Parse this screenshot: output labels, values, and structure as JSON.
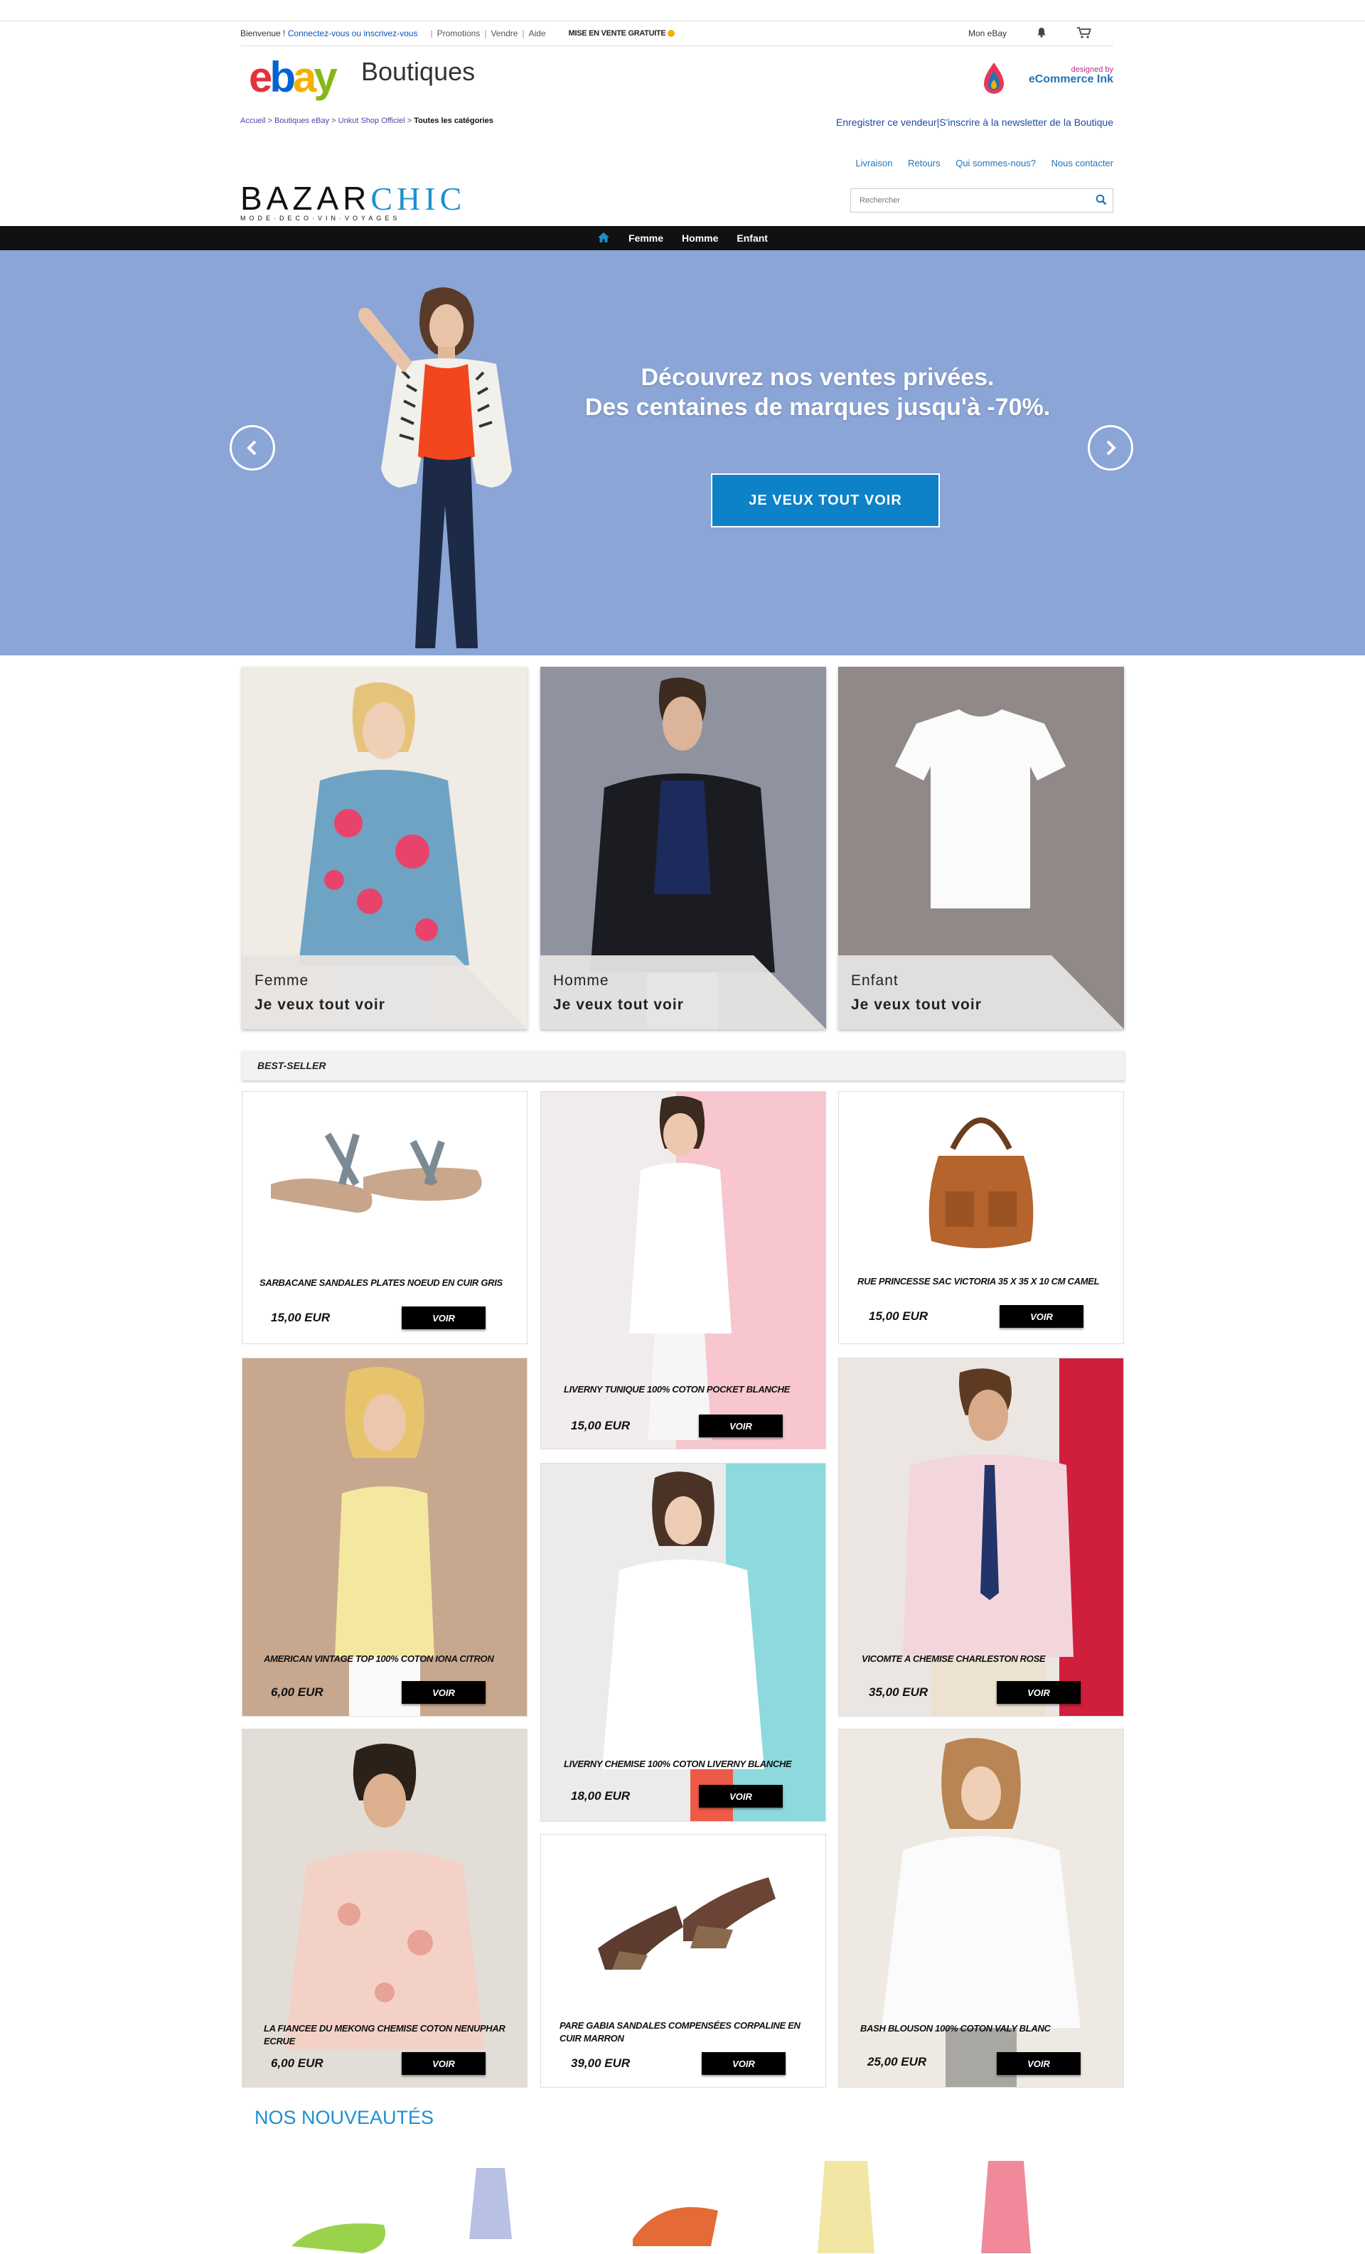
{
  "topbar": {
    "welcome": "Bienvenue !",
    "login": "Connectez-vous ou inscrivez-vous",
    "links": [
      "Promotions",
      "Vendre",
      "Aide"
    ],
    "free_listing": "MISE EN VENTE GRATUITE",
    "my_ebay": "Mon eBay"
  },
  "header": {
    "logo": {
      "e": "e",
      "b": "b",
      "a": "a",
      "y": "y"
    },
    "section": "Boutiques",
    "designed_by": "designed by",
    "designer": "eCommerce Ink"
  },
  "breadcrumb": {
    "items": [
      "Accueil",
      "Boutiques eBay",
      "Unkut Shop Officiel"
    ],
    "current": "Toutes les catégories",
    "sep": ">",
    "register": "Enregistrer ce vendeur",
    "newsletter": "S'inscrire à la newsletter de la Boutique"
  },
  "store": {
    "nav": [
      "Livraison",
      "Retours",
      "Qui sommes-nous?",
      "Nous contacter"
    ],
    "brand_a": "BAZAR",
    "brand_b": "CHIC",
    "tagline": "MODE·DECO·VIN·VOYAGES",
    "search_placeholder": "Rechercher"
  },
  "menu": {
    "items": [
      "Femme",
      "Homme",
      "Enfant"
    ]
  },
  "hero": {
    "line1": "Découvrez nos ventes privées.",
    "line2": "Des centaines de marques jusqu'à -70%.",
    "cta": "JE VEUX TOUT VOIR",
    "bg": "#8aa5d6"
  },
  "categories": [
    {
      "name": "Femme",
      "cta": "Je veux tout voir"
    },
    {
      "name": "Homme",
      "cta": "Je veux tout voir"
    },
    {
      "name": "Enfant",
      "cta": "Je veux tout voir"
    }
  ],
  "bestseller": {
    "title": "BEST-SELLER",
    "voir": "VOIR",
    "products": [
      {
        "title": "SARBACANE SANDALES PLATES NOEUD EN CUIR GRIS",
        "price": "15,00 EUR"
      },
      {
        "title": "LIVERNY TUNIQUE 100% COTON POCKET BLANCHE",
        "price": "15,00 EUR"
      },
      {
        "title": "RUE PRINCESSE SAC VICTORIA 35 X 35 X 10 CM CAMEL",
        "price": "15,00 EUR"
      },
      {
        "title": "AMERICAN VINTAGE TOP 100% COTON IONA CITRON",
        "price": "6,00 EUR"
      },
      {
        "title": "LIVERNY CHEMISE 100% COTON LIVERNY BLANCHE",
        "price": "18,00 EUR"
      },
      {
        "title": "VICOMTE A CHEMISE CHARLESTON ROSE",
        "price": "35,00 EUR"
      },
      {
        "title": "LA FIANCEE DU MEKONG CHEMISE COTON NENUPHAR ECRUE",
        "price": "6,00 EUR"
      },
      {
        "title": "PARE GABIA SANDALES COMPENSÉES CORPALINE EN CUIR MARRON",
        "price": "39,00 EUR"
      },
      {
        "title": "BASH BLOUSON 100% COTON VALY BLANC",
        "price": "25,00 EUR"
      }
    ]
  },
  "nouveautes": {
    "title": "NOS NOUVEAUTÉS"
  },
  "colors": {
    "link": "#0654ba",
    "accent": "#1f8fd1",
    "cta": "#0d82c8",
    "menu": "#111111"
  }
}
